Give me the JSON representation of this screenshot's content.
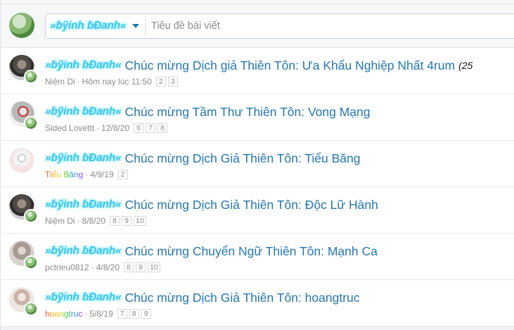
{
  "quick_thread": {
    "prefix_label": "»ɓỹinh ɓĐanh«",
    "title_placeholder": "Tiêu đề bài viết"
  },
  "threads": [
    {
      "prefix": "»ɓỹinh ɓĐanh«",
      "title": "Chúc mừng Dịch giả Thiên Tôn: Ưa Khẩu Nghiệp Nhất 4rum",
      "extra": "(25",
      "author": "Niệm Di",
      "date": "Hôm nay lúc 11:50",
      "pages": [
        "2",
        "3"
      ]
    },
    {
      "prefix": "»ɓỹinh ɓĐanh«",
      "title": "Chúc mừng Tầm Thư Thiên Tôn: Vong Mạng",
      "author": "Sided Lovettt",
      "date": "12/8/20",
      "pages": [
        "6",
        "7",
        "8"
      ]
    },
    {
      "prefix": "»ɓỹinh ɓĐanh«",
      "title": "Chúc mừng Dịch Giả Thiên Tôn: Tiểu Băng",
      "author": "Tiểu Băng",
      "date": "4/9/19",
      "pages": [
        "2"
      ]
    },
    {
      "prefix": "»ɓỹinh ɓĐanh«",
      "title": "Chúc mừng Dịch Giả Thiên Tôn: Độc Lữ Hành",
      "author": "Niệm Di",
      "date": "8/8/20",
      "pages": [
        "8",
        "9",
        "10"
      ]
    },
    {
      "prefix": "»ɓỹinh ɓĐanh«",
      "title": "Chúc mừng Chuyển Ngữ Thiên Tôn: Mạnh Ca",
      "author": "pctrieu0812",
      "date": "4/8/20",
      "pages": [
        "8",
        "9",
        "10"
      ]
    },
    {
      "prefix": "»ɓỹinh ɓĐanh«",
      "title": "Chúc mừng Dịch Giả Thiên Tôn: hoangtruc",
      "author": "hoangtruc",
      "date": "5/8/19",
      "pages": [
        "7",
        "8",
        "9"
      ]
    }
  ],
  "colors": {
    "link": "#2577b1",
    "prefix_glow": "#41c6e8",
    "meta": "#8c8c8c"
  }
}
